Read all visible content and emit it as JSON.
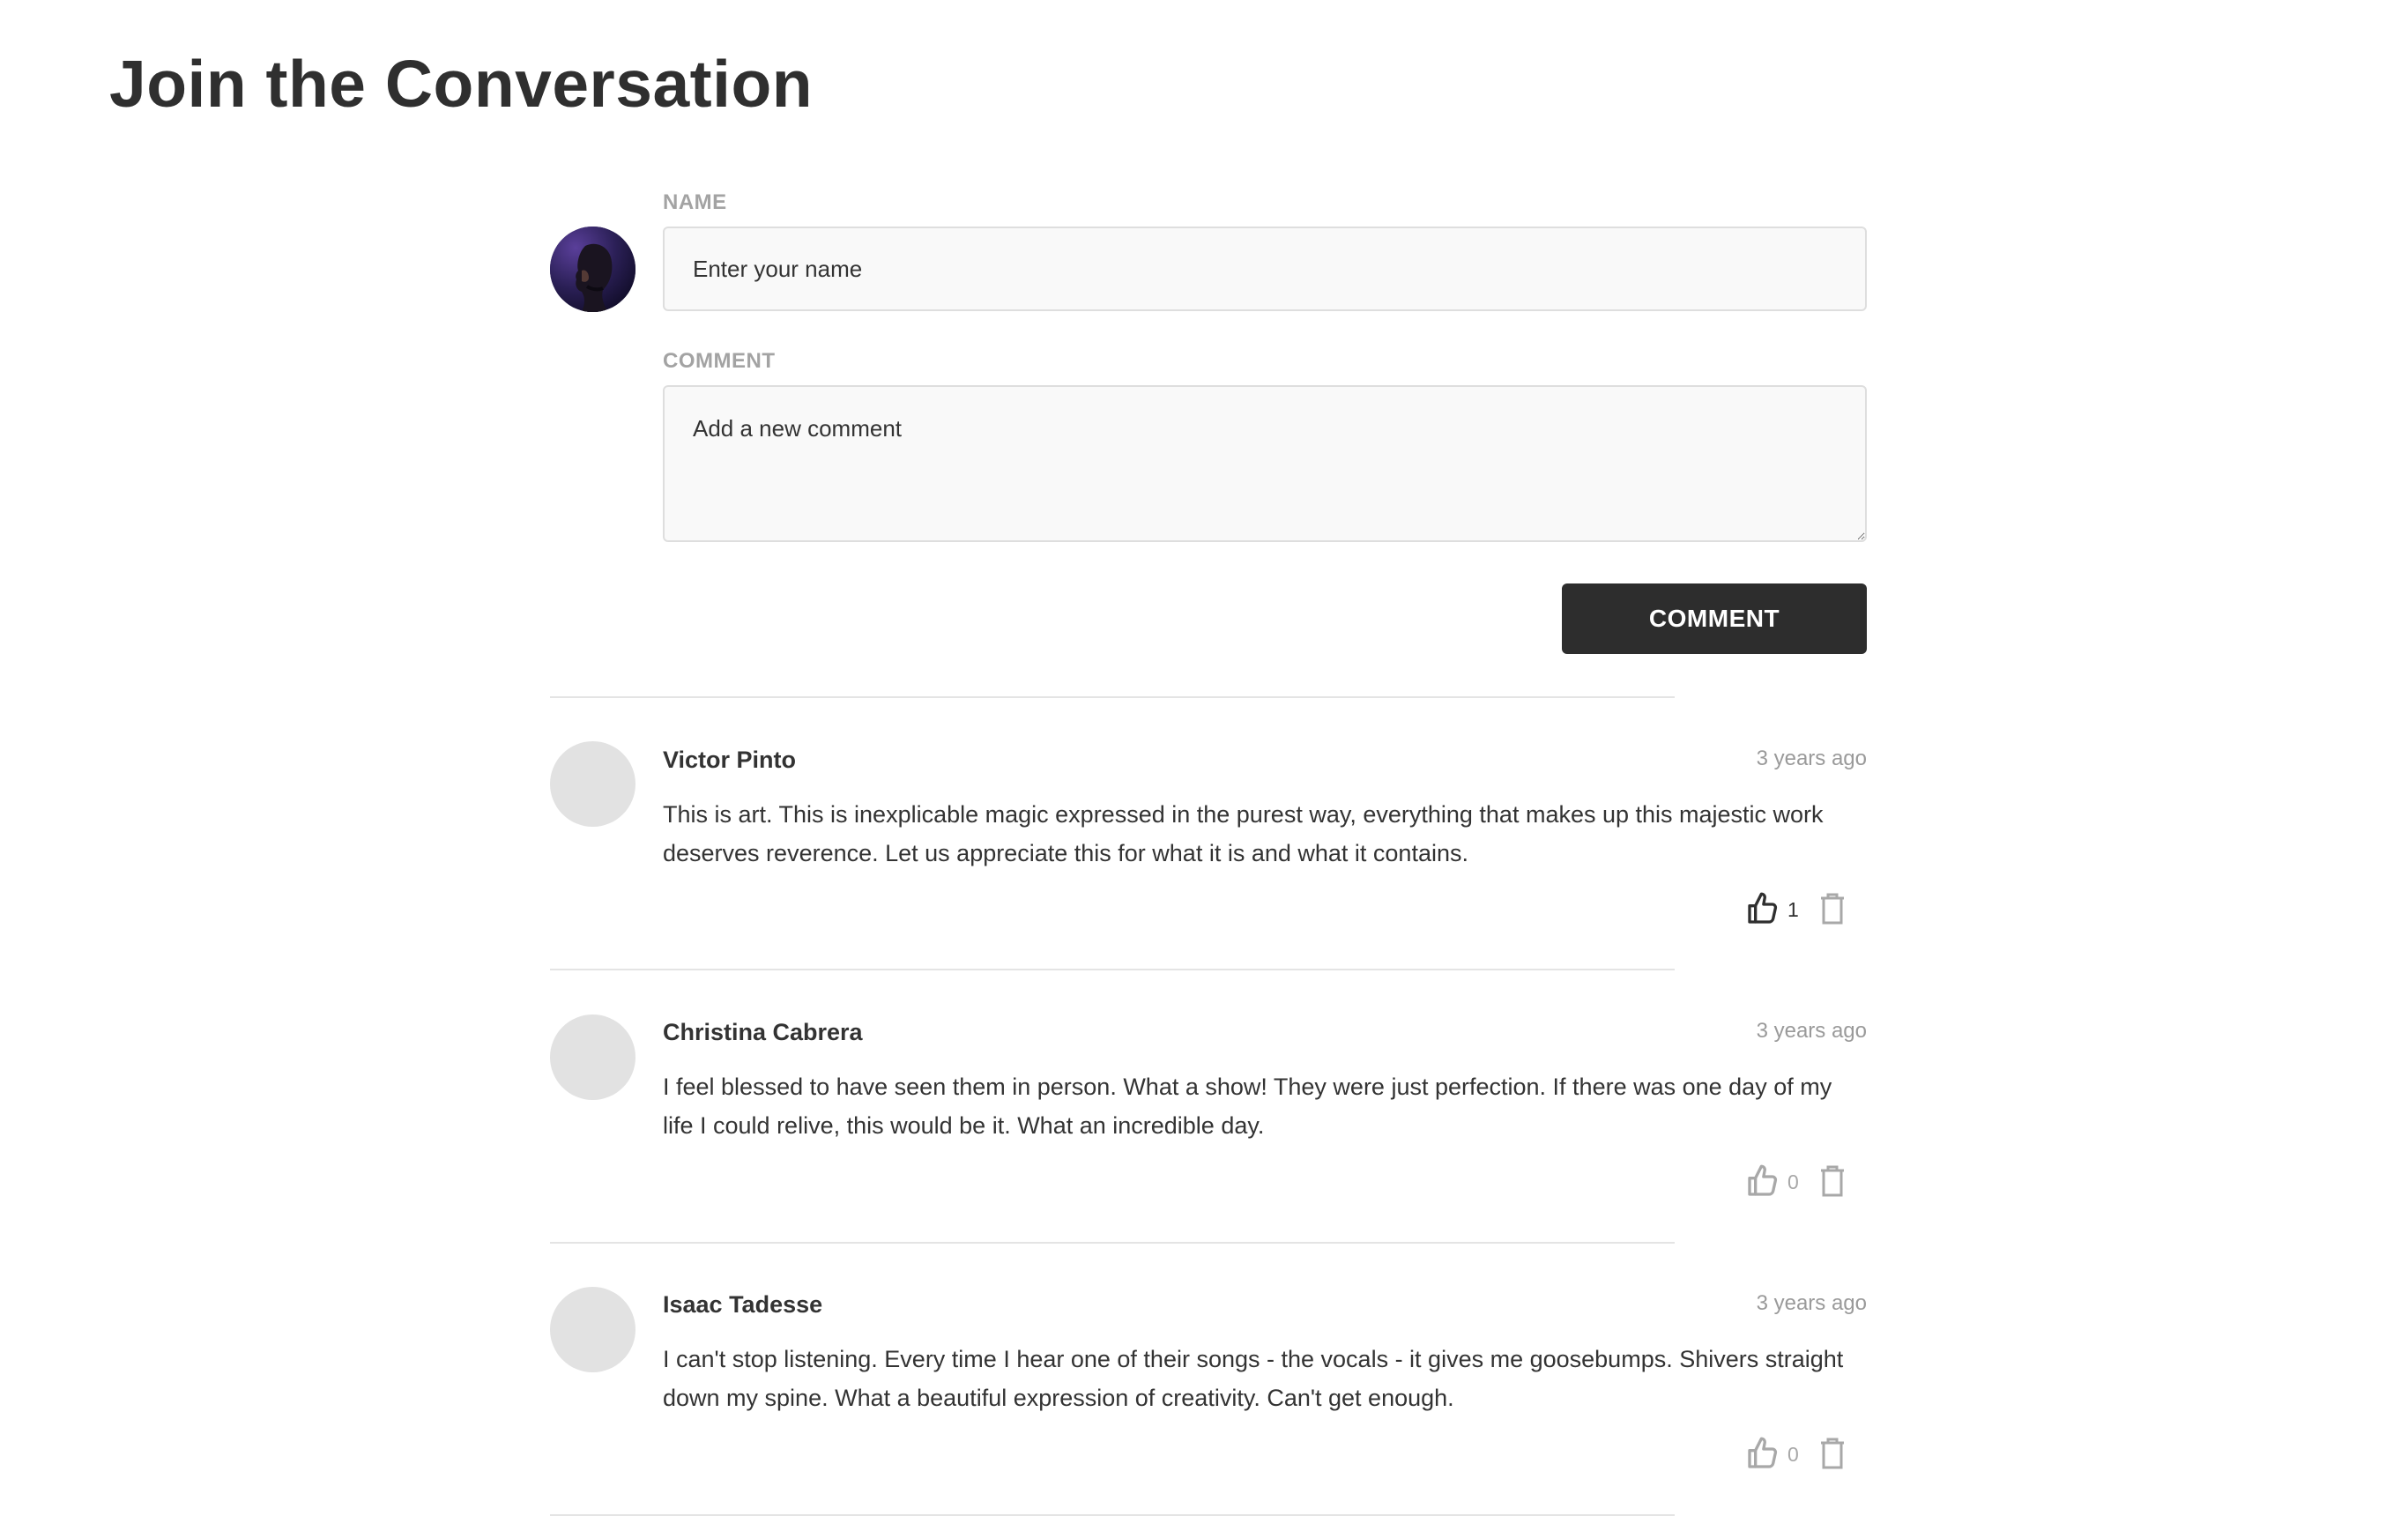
{
  "page": {
    "title": "Join the Conversation"
  },
  "form": {
    "name_label": "NAME",
    "name_placeholder": "Enter your name",
    "name_value": "",
    "comment_label": "COMMENT",
    "comment_placeholder": "Add a new comment",
    "comment_value": "",
    "submit_label": "COMMENT",
    "avatar_icon": "user-photo"
  },
  "comments": [
    {
      "author": "Victor Pinto",
      "time": "3 years ago",
      "text": "This is art. This is inexplicable magic expressed in the purest way, everything that makes up this majestic work deserves reverence. Let us appreciate this for what it is and what it contains.",
      "likes": "1",
      "liked": true
    },
    {
      "author": "Christina Cabrera",
      "time": "3 years ago",
      "text": "I feel blessed to have seen them in person. What a show! They were just perfection. If there was one day of my life I could relive, this would be it. What an incredible day.",
      "likes": "0",
      "liked": false
    },
    {
      "author": "Isaac Tadesse",
      "time": "3 years ago",
      "text": "I can't stop listening. Every time I hear one of their songs - the vocals - it gives me goosebumps. Shivers straight down my spine. What a beautiful expression of creativity. Can't get enough.",
      "likes": "0",
      "liked": false
    }
  ],
  "icons": {
    "like": "thumbs-up-icon",
    "delete": "trash-icon"
  },
  "colors": {
    "button_bg": "#2d2d2d",
    "liked_icon": "#2f2f2f",
    "unliked_icon": "#a8a8a8",
    "avatar_placeholder": "#e2e2e2"
  }
}
